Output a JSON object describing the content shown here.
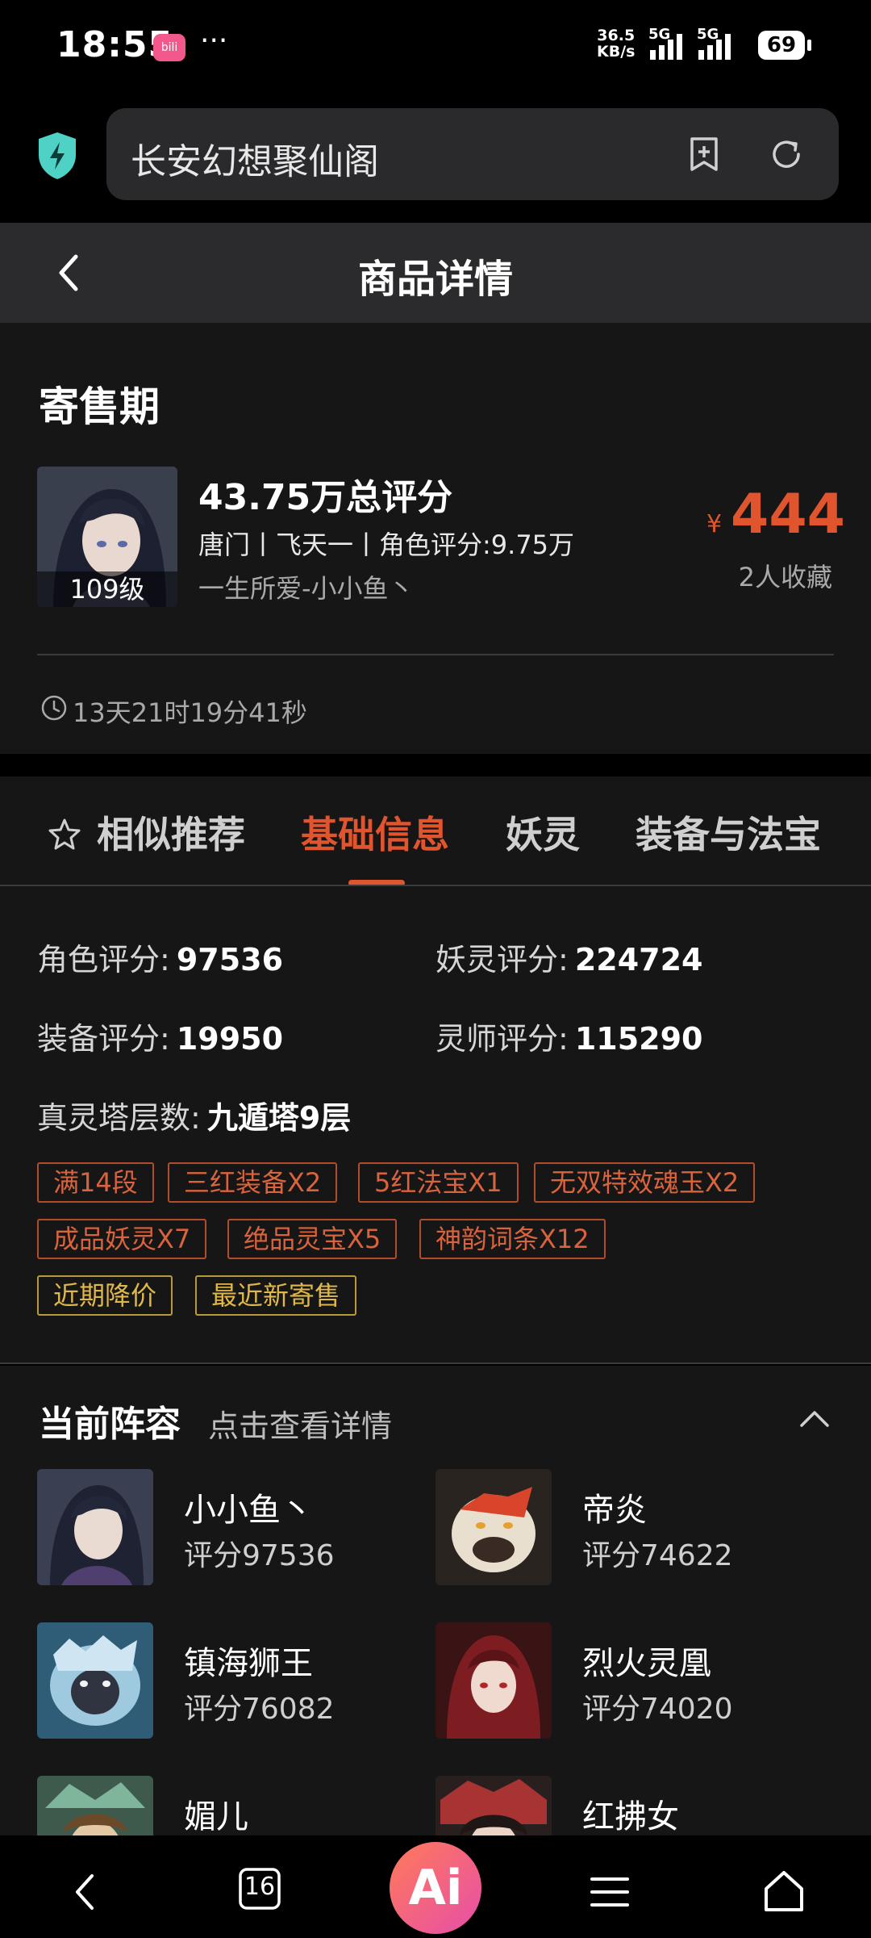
{
  "status_bar": {
    "time": "18:55",
    "app_badge": "bili",
    "more": "···",
    "net_speed_value": "36.5",
    "net_speed_unit": "KB/s",
    "sim1": "5G",
    "sim2": "5G",
    "battery": "69"
  },
  "browser": {
    "url": "长安幻想聚仙阁"
  },
  "page": {
    "title": "商品详情"
  },
  "item": {
    "period": "寄售期",
    "total_score": "43.75万总评分",
    "desc": "唐门丨飞天一丨角色评分:9.75万",
    "seller": "一生所爱-小小鱼丶",
    "level": "109级",
    "currency": "¥",
    "price": "444",
    "favorites": "2人收藏",
    "countdown": "13天21时19分41秒"
  },
  "tabs": [
    {
      "label": "相似推荐",
      "active": false
    },
    {
      "label": "基础信息",
      "active": true
    },
    {
      "label": "妖灵",
      "active": false
    },
    {
      "label": "装备与法宝",
      "active": false
    }
  ],
  "basic": {
    "role_score_label": "角色评分:",
    "role_score": "97536",
    "yaoling_score_label": "妖灵评分:",
    "yaoling_score": "224724",
    "equip_score_label": "装备评分:",
    "equip_score": "19950",
    "lingshi_score_label": "灵师评分:",
    "lingshi_score": "115290",
    "tower_label": "真灵塔层数:",
    "tower": "九遁塔9层",
    "tags_red": [
      "满14段",
      "三红装备X2",
      "5红法宝X1",
      "无双特效魂玉X2",
      "成品妖灵X7",
      "绝品灵宝X5",
      "神韵词条X12"
    ],
    "tags_gold": [
      "近期降价",
      "最近新寄售"
    ]
  },
  "lineup": {
    "title": "当前阵容",
    "hint": "点击查看详情",
    "members": [
      {
        "name": "小小鱼丶",
        "score": "评分97536"
      },
      {
        "name": "帝炎",
        "score": "评分74622"
      },
      {
        "name": "镇海狮王",
        "score": "评分76082"
      },
      {
        "name": "烈火灵凰",
        "score": "评分74020"
      },
      {
        "name": "媚儿",
        "score": ""
      },
      {
        "name": "红拂女",
        "score": ""
      }
    ]
  },
  "bottom_nav": {
    "tab_count": "16",
    "ai_label": "Ai"
  },
  "colors": {
    "accent": "#e0552e",
    "card_bg": "#161616",
    "header_bg": "#2b2b2d",
    "tag_gold": "#e0b84a"
  }
}
